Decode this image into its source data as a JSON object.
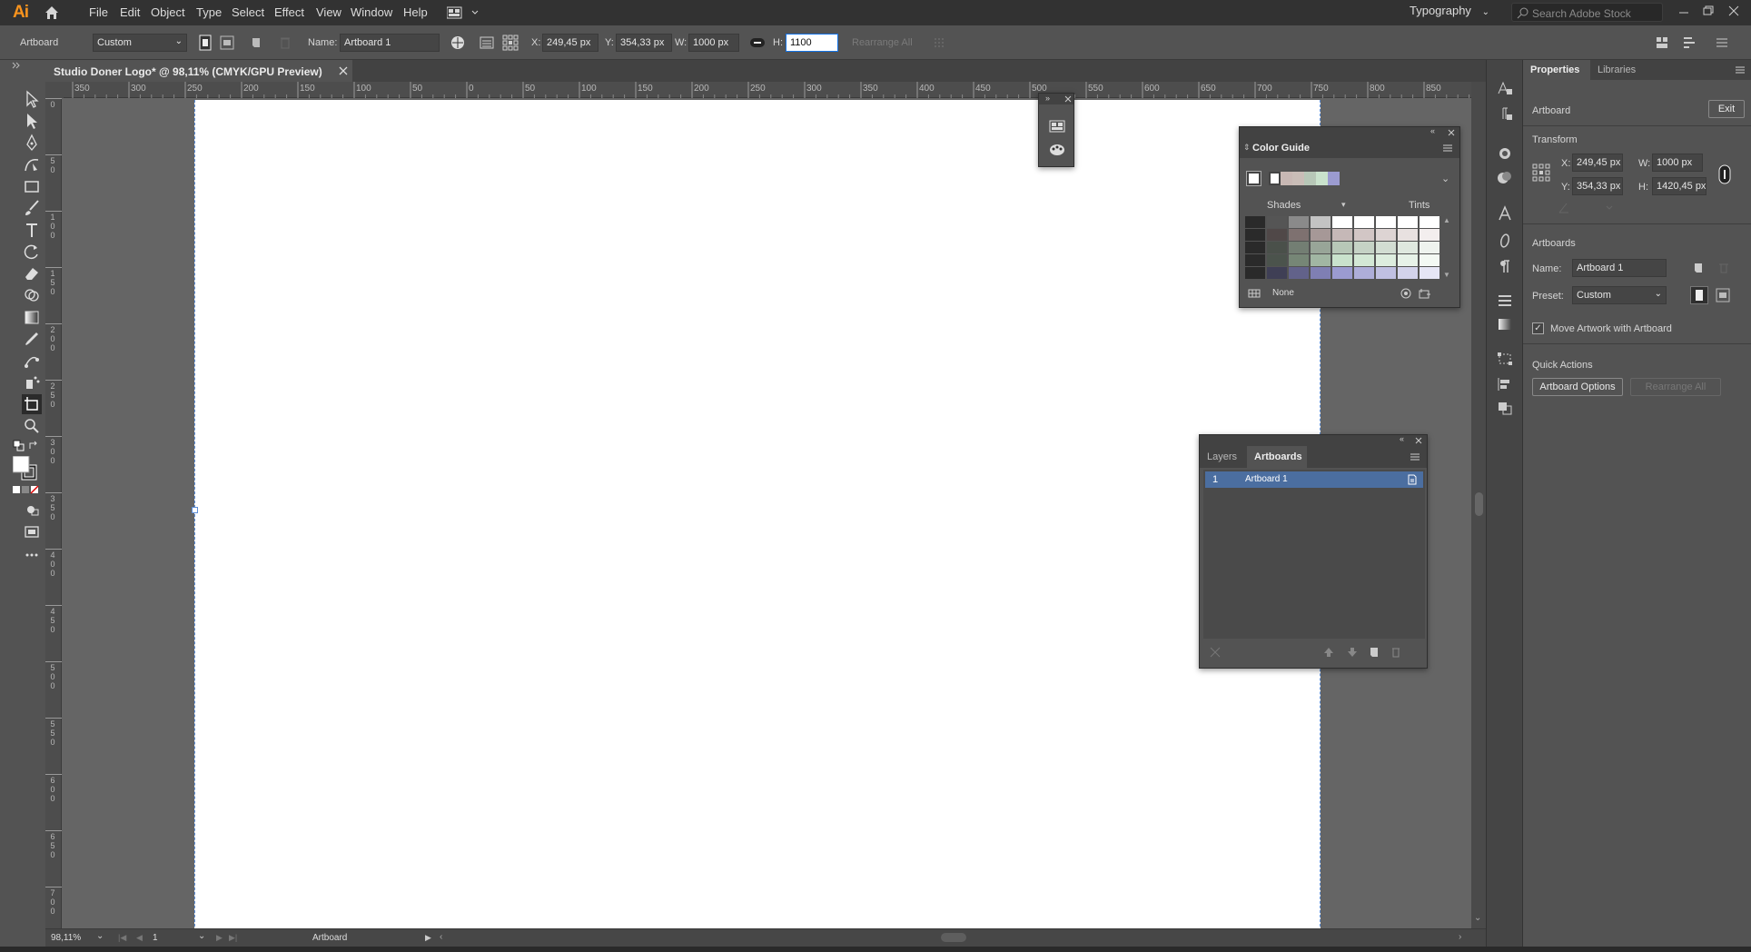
{
  "app": {
    "logo_text": "Ai",
    "menu": [
      "File",
      "Edit",
      "Object",
      "Type",
      "Select",
      "Effect",
      "View",
      "Window",
      "Help"
    ],
    "workspace": "Typography",
    "stock_search_placeholder": "Search Adobe Stock",
    "accent_color": "#f7931e",
    "window_controls": [
      "minimize-icon",
      "restore-icon",
      "close-icon"
    ]
  },
  "control_bar": {
    "mode_label": "Artboard",
    "preset": "Custom",
    "name_label": "Name:",
    "name_value": "Artboard 1",
    "x_label": "X:",
    "x_value": "249,45 px",
    "y_label": "Y:",
    "y_value": "354,33 px",
    "w_label": "W:",
    "w_value": "1000 px",
    "h_label": "H:",
    "h_value": "1100",
    "rearrange_label": "Rearrange All"
  },
  "document": {
    "tab_title": "Studio Doner Logo* @ 98,11% (CMYK/GPU Preview)",
    "ruler_h": [
      "350",
      "300",
      "250",
      "200",
      "150",
      "100",
      "50",
      "0",
      "50",
      "100",
      "150",
      "200",
      "250",
      "300",
      "350",
      "400",
      "450",
      "500",
      "550",
      "600",
      "650",
      "700",
      "750",
      "800",
      "850"
    ],
    "ruler_v": [
      "0",
      "50",
      "100",
      "150",
      "200",
      "250",
      "300",
      "350",
      "400",
      "450",
      "500",
      "550",
      "600",
      "650",
      "700"
    ]
  },
  "status_bar": {
    "zoom": "98,11%",
    "artboard_number": "1",
    "tool_status": "Artboard"
  },
  "color_guide": {
    "title": "Color Guide",
    "shades_label": "Shades",
    "tints_label": "Tints",
    "none_label": "None",
    "harmony": [
      "#c8b8b4",
      "#c9bdb7",
      "#b7c7b7",
      "#c9e2cc",
      "#9b9bd0"
    ],
    "grid": [
      [
        "#2a2a2a",
        "#555555",
        "#8a8a8a",
        "#c3c3c3",
        "#ffffff",
        "#ffffff",
        "#ffffff",
        "#ffffff",
        "#ffffff"
      ],
      [
        "#2a2a2a",
        "#504848",
        "#7e7170",
        "#a69897",
        "#c5b8b7",
        "#d2c6c5",
        "#ddd4d3",
        "#e8e1e0",
        "#f3eeee"
      ],
      [
        "#2a2a2a",
        "#4a504a",
        "#737e73",
        "#98a598",
        "#b7c7b7",
        "#c5d2c5",
        "#d2ddd2",
        "#dfe8df",
        "#eef3ee"
      ],
      [
        "#2a2a2a",
        "#4b534c",
        "#768676",
        "#a1b6a3",
        "#c9e2cc",
        "#d3e8d5",
        "#ddedde",
        "#e7f2e8",
        "#f3f9f3"
      ],
      [
        "#2a2a2a",
        "#3f3f55",
        "#62628a",
        "#7f7fb3",
        "#9b9bd0",
        "#aeaed9",
        "#c0c0e2",
        "#d3d3eb",
        "#e6e6f5"
      ]
    ]
  },
  "artboards_panel": {
    "tabs": [
      "Layers",
      "Artboards"
    ],
    "active_tab": "Artboards",
    "rows": [
      {
        "number": "1",
        "name": "Artboard 1"
      }
    ],
    "selected_color": "#4b6ea0"
  },
  "properties": {
    "tabs": [
      "Properties",
      "Libraries"
    ],
    "context_label": "Artboard",
    "exit_label": "Exit",
    "transform_label": "Transform",
    "x_label": "X:",
    "x_value": "249,45 px",
    "y_label": "Y:",
    "y_value": "354,33 px",
    "w_label": "W:",
    "w_value": "1000 px",
    "h_label": "H:",
    "h_value": "1420,45 px",
    "artboards_label": "Artboards",
    "name_label": "Name:",
    "name_value": "Artboard 1",
    "preset_label": "Preset:",
    "preset_value": "Custom",
    "move_artwork_label": "Move Artwork with Artboard",
    "move_artwork_checked": true,
    "quick_actions_label": "Quick Actions",
    "artboard_options_label": "Artboard Options",
    "rearrange_label": "Rearrange All"
  }
}
